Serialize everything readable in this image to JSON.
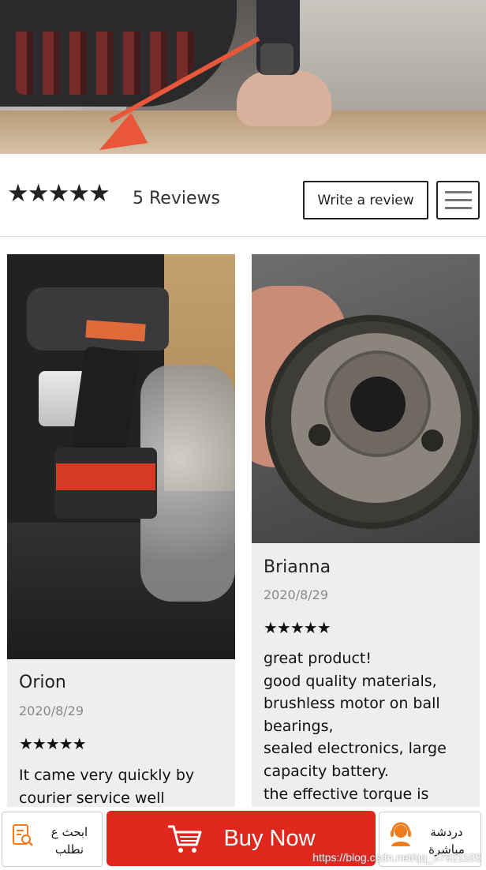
{
  "rating": {
    "stars": "★★★★★",
    "reviews_label": "5 Reviews",
    "write_review_label": "Write a review"
  },
  "reviews": [
    {
      "name": "Orion",
      "date": "2020/8/29",
      "stars": "★★★★★",
      "text": "It came very quickly by\ncourier service well"
    },
    {
      "name": "Brianna",
      "date": "2020/8/29",
      "stars": "★★★★★",
      "text": "great product!\ngood quality materials,\nbrushless motor on ball\nbearings,\nsealed electronics, large\ncapacity battery.\nthe effective torque is"
    }
  ],
  "bottom_bar": {
    "search_order_label": "ابحث ع\nنطلب",
    "buy_now_label": "Buy Now",
    "live_chat_label": "دردشة\nمباشرة"
  },
  "watermark": "https://blog.csdn.net/qq_37921105",
  "colors": {
    "buy_button": "#e0271e",
    "arrow": "#e9573a",
    "card_bg": "#eeeeee",
    "icon_accent": "#f07c1e"
  },
  "icons": [
    "menu-icon",
    "cart-icon",
    "search-order-icon",
    "support-agent-icon"
  ]
}
